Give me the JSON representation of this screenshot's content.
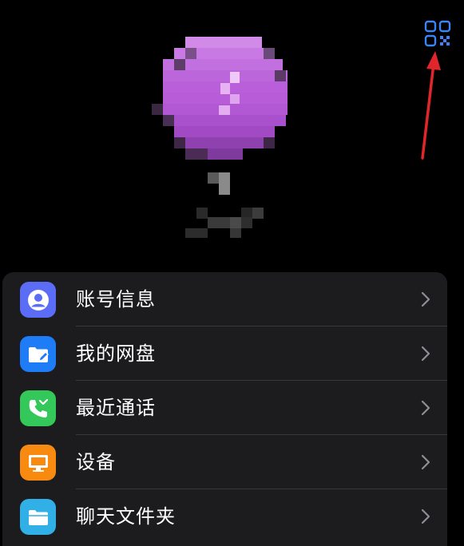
{
  "header": {
    "qr_icon": "qr-code-icon"
  },
  "profile": {
    "avatar": "pixelated-balloon-avatar"
  },
  "annotation": {
    "arrow_color": "#e0262b"
  },
  "menu": {
    "items": [
      {
        "label": "账号信息",
        "icon": "person-icon",
        "icon_color": "#5b6cf6"
      },
      {
        "label": "我的网盘",
        "icon": "folder-edit-icon",
        "icon_color": "#1e7cf6"
      },
      {
        "label": "最近通话",
        "icon": "phone-call-icon",
        "icon_color": "#34c759"
      },
      {
        "label": "设备",
        "icon": "monitor-icon",
        "icon_color": "#f78a0f"
      },
      {
        "label": "聊天文件夹",
        "icon": "folder-icon",
        "icon_color": "#30b0e6"
      }
    ]
  },
  "colors": {
    "background": "#000000",
    "card": "#1c1c1e",
    "divider": "#38383a",
    "chevron": "#8e8e93",
    "accent_blue": "#3d82f7"
  }
}
